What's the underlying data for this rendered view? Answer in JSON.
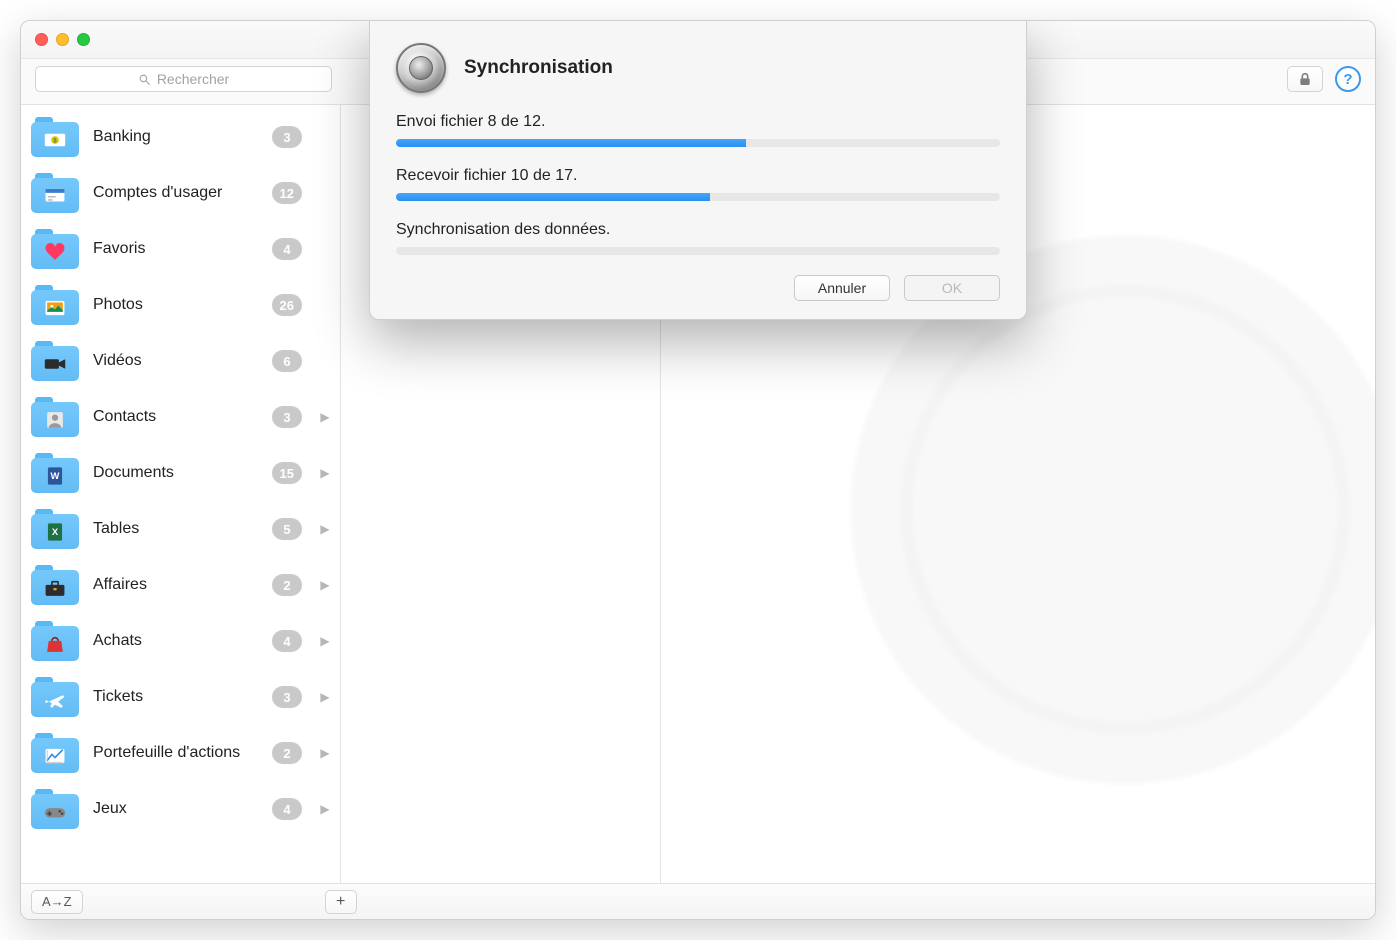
{
  "search": {
    "placeholder": "Rechercher"
  },
  "toolbar": {
    "lock_name": "lock-icon",
    "help_name": "help-icon",
    "help_glyph": "?"
  },
  "sidebar": {
    "items": [
      {
        "label": "Banking",
        "count": "3",
        "disclosure": false,
        "icon": "money"
      },
      {
        "label": "Comptes d'usager",
        "count": "12",
        "disclosure": false,
        "icon": "accounts"
      },
      {
        "label": "Favoris",
        "count": "4",
        "disclosure": false,
        "icon": "heart"
      },
      {
        "label": "Photos",
        "count": "26",
        "disclosure": false,
        "icon": "photos"
      },
      {
        "label": "Vidéos",
        "count": "6",
        "disclosure": false,
        "icon": "video"
      },
      {
        "label": "Contacts",
        "count": "3",
        "disclosure": true,
        "icon": "contact"
      },
      {
        "label": "Documents",
        "count": "15",
        "disclosure": true,
        "icon": "word"
      },
      {
        "label": "Tables",
        "count": "5",
        "disclosure": true,
        "icon": "excel"
      },
      {
        "label": "Affaires",
        "count": "2",
        "disclosure": true,
        "icon": "briefcase"
      },
      {
        "label": "Achats",
        "count": "4",
        "disclosure": true,
        "icon": "bag"
      },
      {
        "label": "Tickets",
        "count": "3",
        "disclosure": true,
        "icon": "plane"
      },
      {
        "label": "Portefeuille d'actions",
        "count": "2",
        "disclosure": true,
        "icon": "stocks"
      },
      {
        "label": "Jeux",
        "count": "4",
        "disclosure": true,
        "icon": "gamepad"
      }
    ]
  },
  "bottombar": {
    "sort_label": "A→Z",
    "add_label": "+"
  },
  "modal": {
    "title": "Synchronisation",
    "tasks": [
      {
        "label": "Envoi fichier 8 de 12.",
        "progress": 58
      },
      {
        "label": "Recevoir fichier 10 de 17.",
        "progress": 52
      },
      {
        "label": "Synchronisation des données.",
        "progress": 0
      }
    ],
    "cancel_label": "Annuler",
    "ok_label": "OK"
  }
}
